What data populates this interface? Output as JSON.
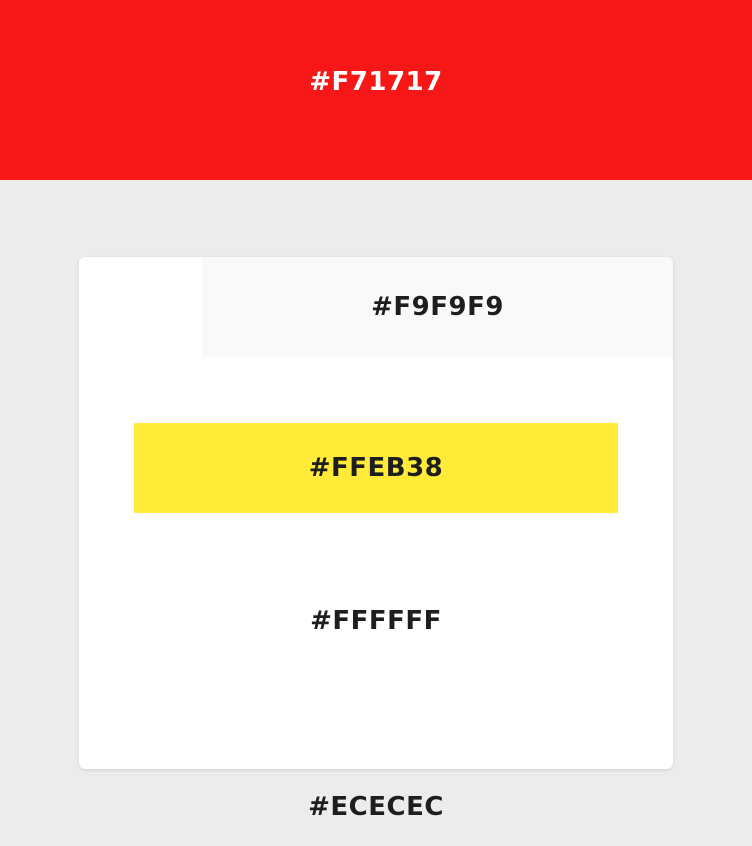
{
  "header": {
    "color": "#F71717",
    "label": "#F71717"
  },
  "card": {
    "color": "#FFFFFF",
    "label": "#FFFFFF",
    "strip": {
      "color": "#F9F9F9",
      "label": "#F9F9F9"
    },
    "accent": {
      "color": "#FFEB38",
      "label": "#FFEB38"
    }
  },
  "background": {
    "color": "#ECECEC",
    "label": "#ECECEC"
  }
}
